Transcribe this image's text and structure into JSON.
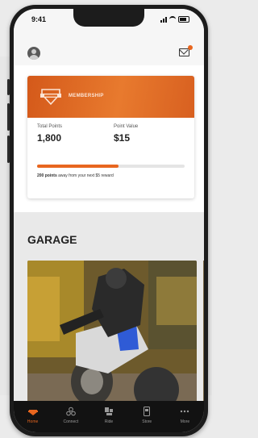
{
  "status_bar": {
    "time": "9:41"
  },
  "membership": {
    "title": "MEMBERSHIP",
    "total_points_label": "Total Points",
    "total_points_value": "1,800",
    "point_value_label": "Point Value",
    "point_value_value": "$15",
    "progress_fraction": 0.55,
    "progress_note_bold": "200 points",
    "progress_note_rest": " away from your next $5 reward"
  },
  "garage": {
    "title": "GARAGE"
  },
  "tabs": [
    {
      "label": "Home",
      "icon": "home-icon",
      "active": true
    },
    {
      "label": "Connect",
      "icon": "connect-icon",
      "active": false
    },
    {
      "label": "Ride",
      "icon": "ride-icon",
      "active": false
    },
    {
      "label": "Store",
      "icon": "store-icon",
      "active": false
    },
    {
      "label": "More",
      "icon": "more-icon",
      "active": false
    }
  ],
  "colors": {
    "accent": "#e8661f",
    "tabbar": "#121212"
  }
}
